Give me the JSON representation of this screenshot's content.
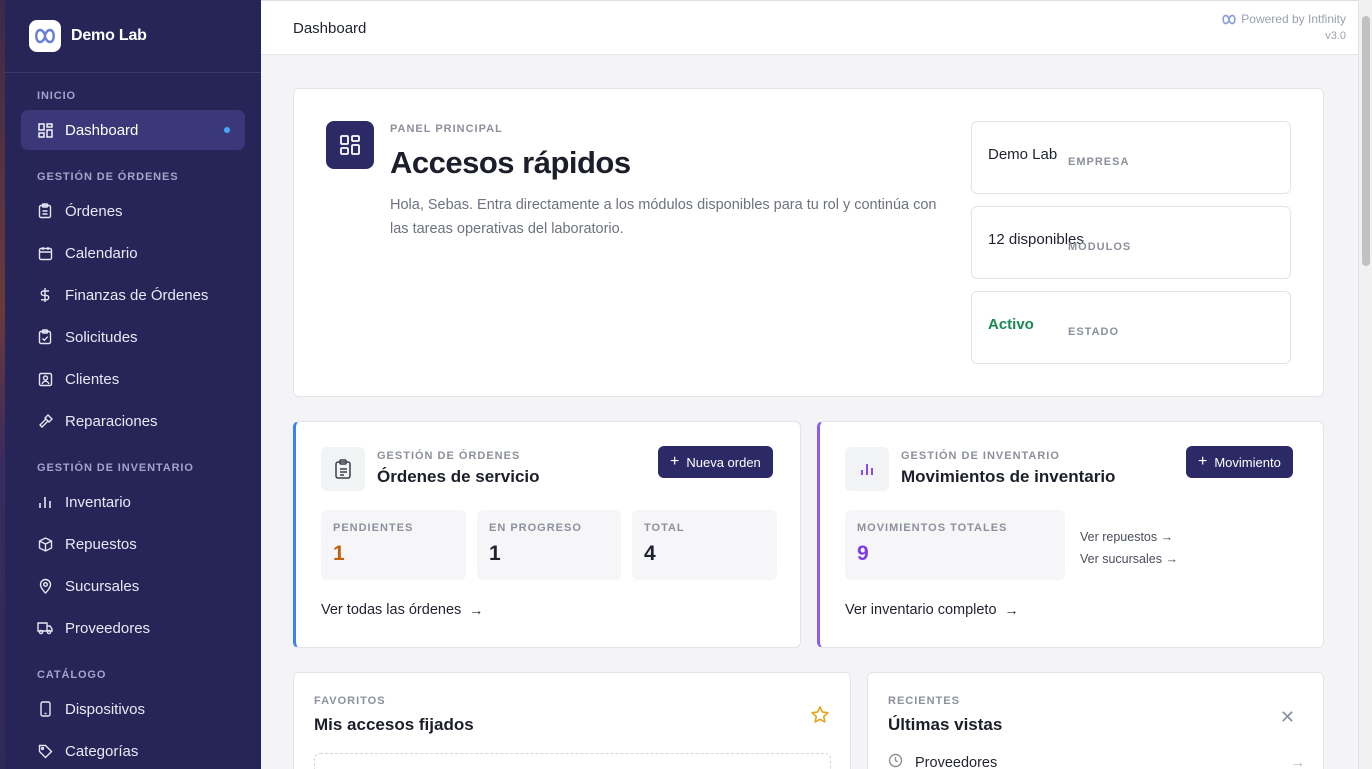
{
  "brand": {
    "name": "Demo Lab"
  },
  "sidebar": {
    "sections": [
      {
        "label": "INICIO"
      },
      {
        "label": "GESTIÓN DE ÓRDENES"
      },
      {
        "label": "GESTIÓN DE INVENTARIO"
      },
      {
        "label": "CATÁLOGO"
      }
    ],
    "items": [
      {
        "label": "Dashboard",
        "icon": "dashboard-icon",
        "active": true
      },
      {
        "label": "Órdenes",
        "icon": "clipboard-icon"
      },
      {
        "label": "Calendario",
        "icon": "calendar-icon"
      },
      {
        "label": "Finanzas de Órdenes",
        "icon": "dollar-icon"
      },
      {
        "label": "Solicitudes",
        "icon": "clipboard-check-icon"
      },
      {
        "label": "Clientes",
        "icon": "contact-icon"
      },
      {
        "label": "Reparaciones",
        "icon": "hammer-icon"
      },
      {
        "label": "Inventario",
        "icon": "bar-chart-icon"
      },
      {
        "label": "Repuestos",
        "icon": "package-icon"
      },
      {
        "label": "Sucursales",
        "icon": "map-pin-icon"
      },
      {
        "label": "Proveedores",
        "icon": "truck-icon"
      },
      {
        "label": "Dispositivos",
        "icon": "smartphone-icon"
      },
      {
        "label": "Categorías",
        "icon": "tag-icon"
      }
    ]
  },
  "topbar": {
    "title": "Dashboard",
    "powered": "Powered by Intfinity",
    "version": "v3.0"
  },
  "hero": {
    "eyebrow": "PANEL PRINCIPAL",
    "title": "Accesos rápidos",
    "description": "Hola, Sebas. Entra directamente a los módulos disponibles para tu rol y continúa con las tareas operativas del laboratorio.",
    "stats": [
      {
        "label": "EMPRESA",
        "value": "Demo Lab"
      },
      {
        "label": "MÓDULOS",
        "value": "12 disponibles"
      },
      {
        "label": "ESTADO",
        "value": "Activo"
      }
    ]
  },
  "orders_card": {
    "eyebrow": "GESTIÓN DE ÓRDENES",
    "title": "Órdenes de servicio",
    "button": "Nueva orden",
    "stats": [
      {
        "label": "PENDIENTES",
        "value": "1",
        "color": "#c2610c"
      },
      {
        "label": "EN PROGRESO",
        "value": "1",
        "color": "#1f2330"
      },
      {
        "label": "TOTAL",
        "value": "4",
        "color": "#1f2330"
      }
    ],
    "link": "Ver todas las órdenes"
  },
  "inventory_card": {
    "eyebrow": "GESTIÓN DE INVENTARIO",
    "title": "Movimientos de inventario",
    "button": "Movimiento",
    "stat": {
      "label": "MOVIMIENTOS TOTALES",
      "value": "9",
      "color": "#7c3aed"
    },
    "side_links": [
      "Ver repuestos →",
      "Ver sucursales →"
    ],
    "link": "Ver inventario completo"
  },
  "favorites": {
    "eyebrow": "FAVORITOS",
    "title": "Mis accesos fijados"
  },
  "recent": {
    "eyebrow": "RECIENTES",
    "title": "Últimas vistas",
    "items": [
      "Proveedores"
    ]
  },
  "colors": {
    "sidebar": "#272458",
    "accent": "#2c2a66",
    "orders": "#3b82f6",
    "inventory": "#8b5cf6",
    "active": "#178a4e"
  }
}
